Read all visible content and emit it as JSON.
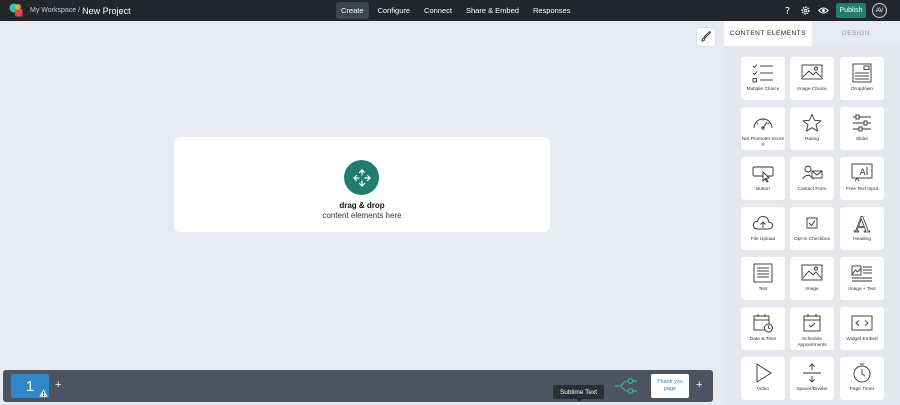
{
  "topbar": {
    "workspace": "My Workspace",
    "separator": "/",
    "project": "New Project",
    "nav": [
      {
        "label": "Create",
        "active": true
      },
      {
        "label": "Configure"
      },
      {
        "label": "Connect"
      },
      {
        "label": "Share & Embed"
      },
      {
        "label": "Responses"
      }
    ],
    "publish_label": "Publish",
    "avatar_initials": "AV",
    "icons": [
      "help-icon",
      "settings-icon",
      "preview-eye-icon"
    ]
  },
  "canvas": {
    "dropzone_title": "drag & drop",
    "dropzone_subtitle": "content elements here"
  },
  "bottombar": {
    "page_number": "1",
    "tooltip": "Sublime Text",
    "thank_you_label": "Thank you page"
  },
  "panel": {
    "tabs": [
      "CONTENT ELEMENTS",
      "DESIGN"
    ],
    "elements": [
      {
        "label": "Multiple Choice",
        "icon": "multiple-choice-icon"
      },
      {
        "label": "Image Choice",
        "icon": "image-choice-icon"
      },
      {
        "label": "Dropdown",
        "icon": "dropdown-icon"
      },
      {
        "label": "Net Promoter Score ®",
        "icon": "gauge-icon"
      },
      {
        "label": "Rating",
        "icon": "star-icon"
      },
      {
        "label": "Slider",
        "icon": "slider-icon"
      },
      {
        "label": "Button",
        "icon": "button-icon"
      },
      {
        "label": "Contact Form",
        "icon": "contact-form-icon"
      },
      {
        "label": "Free Text Input",
        "icon": "text-input-icon"
      },
      {
        "label": "File Upload",
        "icon": "cloud-upload-icon"
      },
      {
        "label": "Opt-In Checkbox",
        "icon": "checkbox-icon"
      },
      {
        "label": "Heading",
        "icon": "heading-icon"
      },
      {
        "label": "Text",
        "icon": "text-icon"
      },
      {
        "label": "Image",
        "icon": "image-icon"
      },
      {
        "label": "Image + Text",
        "icon": "image-text-icon"
      },
      {
        "label": "Date & Time",
        "icon": "calendar-clock-icon"
      },
      {
        "label": "Schedule Appointments",
        "icon": "calendar-icon"
      },
      {
        "label": "Widget Embed",
        "icon": "code-icon"
      },
      {
        "label": "Video",
        "icon": "play-icon"
      },
      {
        "label": "Spacer/Divider",
        "icon": "spacer-icon"
      },
      {
        "label": "Page Timer",
        "icon": "timer-icon"
      }
    ]
  }
}
